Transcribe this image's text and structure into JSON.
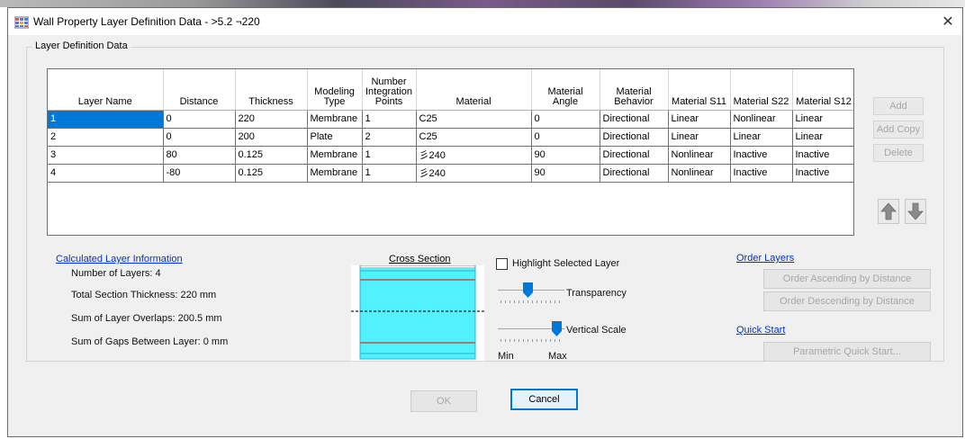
{
  "window": {
    "title": "Wall Property Layer Definition Data - >5.2 ¬220",
    "close_glyph": "✕",
    "icon": "grid-app-icon"
  },
  "group": {
    "label": "Layer Definition Data"
  },
  "table": {
    "columns": [
      {
        "label": "Layer Name",
        "width": 128
      },
      {
        "label": "Distance",
        "width": 80
      },
      {
        "label": "Thickness",
        "width": 80
      },
      {
        "label": "Modeling\nType",
        "width": 61
      },
      {
        "label": "Number\nIntegration\nPoints",
        "width": 60
      },
      {
        "label": "Material",
        "width": 128
      },
      {
        "label": "Material\nAngle",
        "width": 76
      },
      {
        "label": "Material\nBehavior",
        "width": 76
      },
      {
        "label": "Material S11",
        "width": 69
      },
      {
        "label": "Material S22",
        "width": 69
      },
      {
        "label": "Material S12",
        "width": 70
      }
    ],
    "rows": [
      [
        "1",
        "0",
        "220",
        "Membrane",
        "1",
        "C25",
        "0",
        "Directional",
        "Linear",
        "Nonlinear",
        "Linear"
      ],
      [
        "2",
        "0",
        "200",
        "Plate",
        "2",
        "C25",
        "0",
        "Directional",
        "Linear",
        "Linear",
        "Linear"
      ],
      [
        "3",
        "80",
        "0.125",
        "Membrane",
        "1",
        "⼺240",
        "90",
        "Directional",
        "Nonlinear",
        "Inactive",
        "Inactive"
      ],
      [
        "4",
        "-80",
        "0.125",
        "Membrane",
        "1",
        "⼺240",
        "90",
        "Directional",
        "Nonlinear",
        "Inactive",
        "Inactive"
      ]
    ],
    "selected_row": 0
  },
  "side_buttons": {
    "add": "Add",
    "add_copy": "Add Copy",
    "delete": "Delete"
  },
  "move_buttons": {
    "up_icon": "arrow-up-icon",
    "down_icon": "arrow-down-icon"
  },
  "calc": {
    "heading": "Calculated Layer Information",
    "num_layers": "Number of Layers:  4",
    "total_thickness": "Total Section Thickness:  220 mm",
    "overlaps": "Sum of Layer Overlaps:  200.5 mm",
    "gaps": "Sum of Gaps Between Layer:  0 mm"
  },
  "cross_section": {
    "label": "Cross Section",
    "fill_color": "#3ff0ff",
    "line_color": "#c0504d"
  },
  "display": {
    "highlight_label": "Highlight Selected Layer",
    "highlight_checked": false,
    "transparency_label": "Transparency",
    "transparency_value": 0.4,
    "vertical_scale_label": "Vertical Scale",
    "vertical_scale_value": 0.85,
    "min_label": "Min",
    "max_label": "Max"
  },
  "order": {
    "heading": "Order Layers",
    "ascending": "Order Ascending by Distance",
    "descending": "Order Descending by Distance"
  },
  "quick_start": {
    "heading": "Quick Start",
    "button": "Parametric Quick Start..."
  },
  "footer": {
    "ok": "OK",
    "cancel": "Cancel"
  },
  "colors": {
    "selection": "#0078d7",
    "link": "#0033cc",
    "slider_thumb": "#0078d7"
  }
}
